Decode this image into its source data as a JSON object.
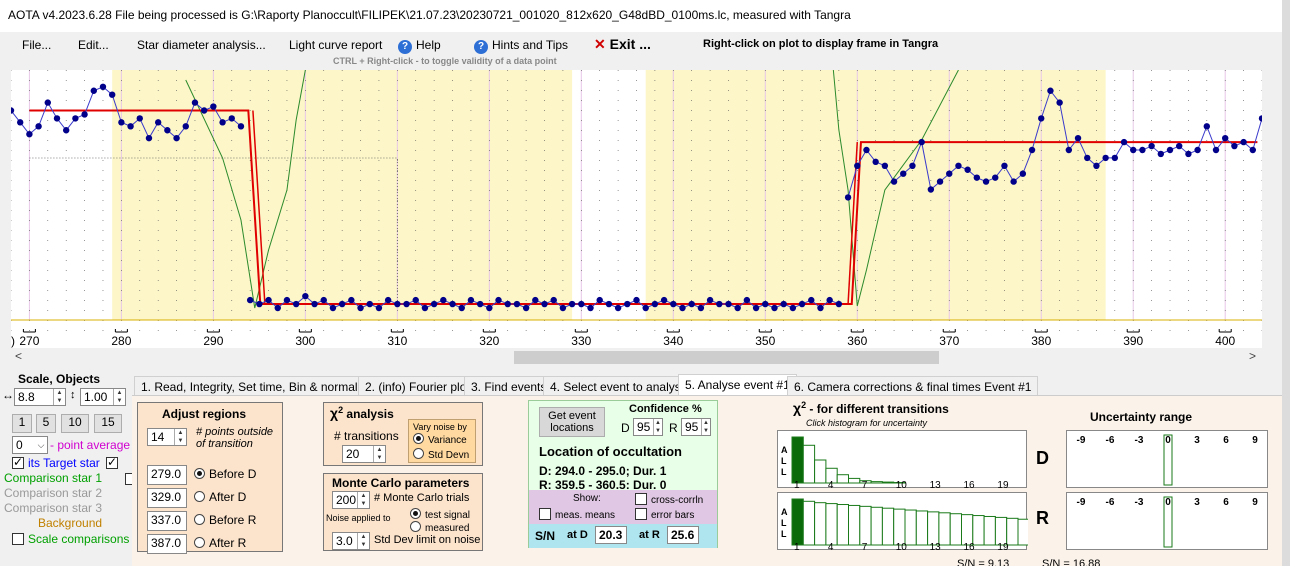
{
  "window": {
    "title": "AOTA v4.2023.6.28   File being processed is G:\\Raporty Planoccult\\FILIPEK\\21.07.23\\20230721_001020_812x620_G48dBD_0100ms.lc, measured with Tangra"
  },
  "menu": {
    "file": "File...",
    "edit": "Edit...",
    "star_diameter": "Star diameter analysis...",
    "light_curve": "Light curve report",
    "help": "Help",
    "hints": "Hints and Tips",
    "exit": "Exit ...",
    "rightclick_hint": "Right-click on plot to display frame in Tangra",
    "ctrl_hint": "CTRL + Right-click  -  to toggle validity of a data point"
  },
  "plot": {
    "x_ticks": [
      "270",
      "280",
      "290",
      "300",
      "310",
      "320",
      "330",
      "340",
      "350",
      "360",
      "370",
      "380",
      "390",
      "400"
    ],
    "left_edge_tick": ")"
  },
  "chart_data": {
    "type": "scatter",
    "x_range": [
      268,
      404
    ],
    "series": [
      {
        "x": [
          268,
          269,
          270,
          271,
          272,
          273,
          274,
          275,
          276,
          277,
          278,
          279,
          280,
          281,
          282,
          283,
          284,
          285,
          286,
          287,
          288,
          289,
          290,
          291,
          292,
          293
        ],
        "y": [
          0.5,
          0.47,
          0.44,
          0.46,
          0.52,
          0.48,
          0.45,
          0.48,
          0.49,
          0.55,
          0.56,
          0.54,
          0.47,
          0.46,
          0.48,
          0.43,
          0.47,
          0.45,
          0.43,
          0.46,
          0.52,
          0.5,
          0.51,
          0.47,
          0.48,
          0.46
        ]
      },
      {
        "x": [
          294,
          295,
          296,
          297,
          298,
          299,
          300,
          301,
          302,
          303,
          304,
          305,
          306,
          307,
          308,
          309,
          310,
          311,
          312,
          313,
          314,
          315,
          316,
          317,
          318,
          319,
          320,
          321,
          322,
          323,
          324,
          325,
          326,
          327,
          328,
          329,
          330,
          331,
          332,
          333,
          334,
          335,
          336,
          337,
          338,
          339,
          340,
          341,
          342,
          343,
          344,
          345,
          346,
          347,
          348,
          349,
          350,
          351,
          352,
          353,
          354,
          355,
          356,
          357,
          358
        ],
        "y": [
          0.02,
          0.01,
          0.02,
          0.0,
          0.02,
          0.01,
          0.03,
          0.01,
          0.02,
          0.0,
          0.01,
          0.02,
          0.0,
          0.01,
          0.0,
          0.02,
          0.01,
          0.01,
          0.02,
          0.0,
          0.01,
          0.02,
          0.01,
          0.0,
          0.02,
          0.01,
          0.0,
          0.02,
          0.01,
          0.01,
          0.0,
          0.02,
          0.01,
          0.02,
          0.0,
          0.01,
          0.01,
          0.0,
          0.02,
          0.01,
          0.0,
          0.01,
          0.02,
          0.0,
          0.01,
          0.02,
          0.01,
          0.0,
          0.01,
          0.0,
          0.02,
          0.01,
          0.01,
          0.0,
          0.02,
          0.0,
          0.01,
          0.0,
          0.01,
          0.0,
          0.01,
          0.02,
          0.0,
          0.02,
          0.01
        ]
      },
      {
        "x": [
          359,
          360,
          361,
          362,
          363,
          364,
          365,
          366,
          367,
          368,
          369,
          370,
          371,
          372,
          373,
          374,
          375,
          376,
          377,
          378,
          379,
          380,
          381,
          382,
          383,
          384,
          385,
          386,
          387,
          388,
          389,
          390,
          391,
          392,
          393,
          394,
          395,
          396,
          397,
          398,
          399,
          400,
          401,
          402,
          403,
          404
        ],
        "y": [
          0.28,
          0.36,
          0.4,
          0.37,
          0.36,
          0.32,
          0.34,
          0.36,
          0.42,
          0.3,
          0.32,
          0.34,
          0.36,
          0.35,
          0.33,
          0.32,
          0.33,
          0.36,
          0.32,
          0.34,
          0.4,
          0.48,
          0.55,
          0.52,
          0.4,
          0.43,
          0.38,
          0.36,
          0.38,
          0.38,
          0.42,
          0.4,
          0.4,
          0.41,
          0.39,
          0.4,
          0.41,
          0.39,
          0.4,
          0.46,
          0.4,
          0.43,
          0.41,
          0.42,
          0.4,
          0.48
        ]
      }
    ],
    "model_line": {
      "baseline": 0.5,
      "event_level": 0.01,
      "after_level": 0.42,
      "D": 294.5,
      "R": 360.0
    },
    "regions": {
      "before_D": 279.0,
      "after_D": 329.0,
      "before_R": 337.0,
      "after_R": 387.0
    }
  },
  "scale_panel": {
    "title": "Scale,  Objects",
    "scale_value": "8.8",
    "scale_value2": "1.00",
    "buttons": [
      "1",
      "5",
      "10",
      "15"
    ],
    "point_average_value": "0",
    "point_average_label": "- point average",
    "target_label": "its  Target star",
    "comp1": "Comparison star 1",
    "comp2": "Comparison star 2",
    "comp3": "Comparison star 3",
    "background": "Background",
    "scale_comparisons": "Scale comparisons"
  },
  "tabs": [
    "1.  Read, Integrity, Set time, Bin & normalise",
    "2. (info)  Fourier plot",
    "3. Find events",
    "4. Select event to analyse",
    "5. Analyse event #1",
    "6. Camera corrections & final times Event #1"
  ],
  "adjust": {
    "title": "Adjust regions",
    "points_value": "14",
    "points_label": "# points outside of transition",
    "regions": [
      {
        "value": "279.0",
        "label": "Before D"
      },
      {
        "value": "329.0",
        "label": "After D"
      },
      {
        "value": "337.0",
        "label": "Before R"
      },
      {
        "value": "387.0",
        "label": "After R"
      }
    ]
  },
  "chi2": {
    "title": "analysis",
    "chi": "χ",
    "sup": "2",
    "transitions_label": "# transitions",
    "transitions_value": "20",
    "vary_label": "Vary noise by",
    "variance": "Variance",
    "stddev": "Std Devn"
  },
  "monte": {
    "title": "Monte Carlo parameters",
    "trials_value": "200",
    "trials_label": "# Monte Carlo trials",
    "noise_applied": "Noise applied to",
    "test_signal": "test signal",
    "measured": "measured",
    "limit_value": "3.0",
    "limit_label": "Std Dev limit on noise"
  },
  "location": {
    "get_btn": "Get event locations",
    "confidence_label": "Confidence %",
    "d_label": "D",
    "r_label": "R",
    "d_conf": "95",
    "r_conf": "95",
    "title": "Location of occultation",
    "d_line": "D: 294.0 - 295.0; Dur. 1",
    "r_line": "R: 359.5 - 360.5; Dur. 0",
    "show": "Show:",
    "cross_corr": "cross-corrln",
    "meas_means": "meas. means",
    "error_bars": "error bars",
    "sn_label": "S/N",
    "at_d": "at D",
    "at_r": "at R",
    "sn_d": "20.3",
    "sn_r": "25.6"
  },
  "histogram": {
    "title": "- for different transitions",
    "chi": "χ",
    "sup": "2",
    "subtitle": "Click histogram for uncertainty",
    "axis_letters": [
      "A",
      "L",
      "L"
    ],
    "ticks": [
      "1",
      "4",
      "7",
      "10",
      "13",
      "16",
      "19"
    ],
    "d_label": "D",
    "r_label": "R",
    "d_values": [
      1.0,
      0.82,
      0.5,
      0.32,
      0.18,
      0.1,
      0.05,
      0.03,
      0.02,
      0.01
    ],
    "r_values": [
      1.0,
      0.95,
      0.92,
      0.9,
      0.88,
      0.86,
      0.84,
      0.82,
      0.8,
      0.78,
      0.76,
      0.74,
      0.72,
      0.7,
      0.68,
      0.66,
      0.64,
      0.62,
      0.6,
      0.58,
      0.56
    ]
  },
  "uncertainty": {
    "title": "Uncertainty range",
    "ticks": [
      "-9",
      "-6",
      "-3",
      "0",
      "3",
      "6",
      "9"
    ]
  },
  "bottom_sn": {
    "left": "S/N =  9.13",
    "right": "S/N =  16.88"
  }
}
